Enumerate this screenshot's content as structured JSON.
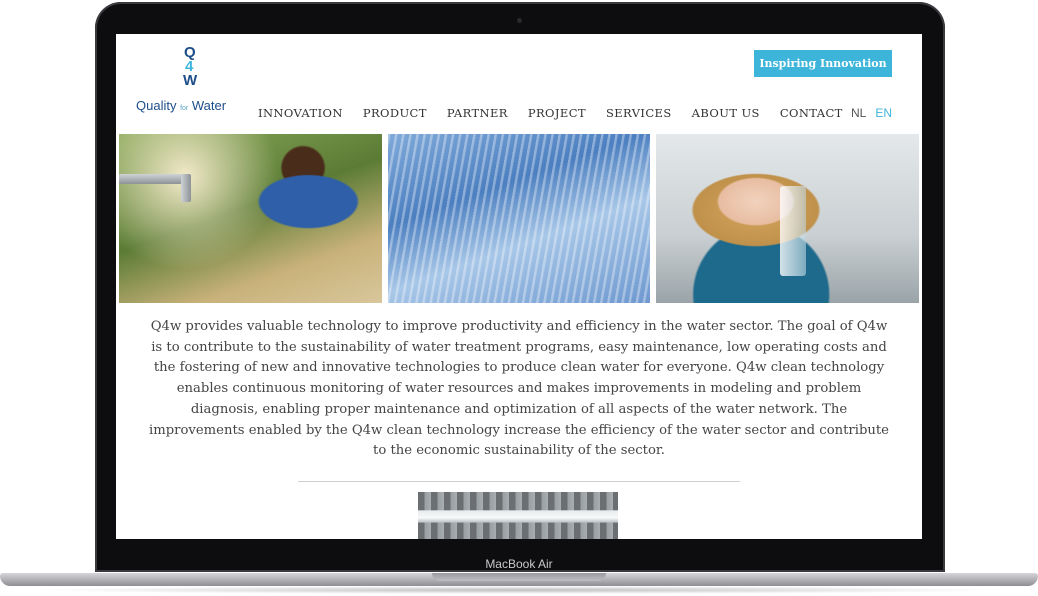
{
  "device": {
    "label": "MacBook Air"
  },
  "site": {
    "logo": {
      "letters": [
        "Q",
        "4",
        "W"
      ],
      "text_left": "Quality",
      "text_small": "for",
      "text_right": "Water"
    },
    "cta_label": "Inspiring Innovation",
    "nav": [
      "INNOVATION",
      "PRODUCT",
      "PARTNER",
      "PROJECT",
      "SERVICES",
      "ABOUT US",
      "CONTACT"
    ],
    "languages": [
      "NL",
      "EN"
    ],
    "active_language": "EN",
    "intro": "Q4w provides valuable technology to improve productivity and efficiency in the water sector. The goal of Q4w is to contribute to the sustainability of water treatment programs, easy maintenance, low operating costs and the fostering of new and innovative technologies to produce clean water for everyone. Q4w clean technology enables continuous monitoring of water resources and makes improvements in modeling and problem diagnosis, enabling proper maintenance and optimization of all aspects of the water network. The improvements enabled by the Q4w clean technology increase the efficiency of the water sector and contribute to the economic sustainability of the sector."
  },
  "colors": {
    "accent": "#3db5da",
    "brand": "#1d4e8a",
    "text": "#444444"
  }
}
